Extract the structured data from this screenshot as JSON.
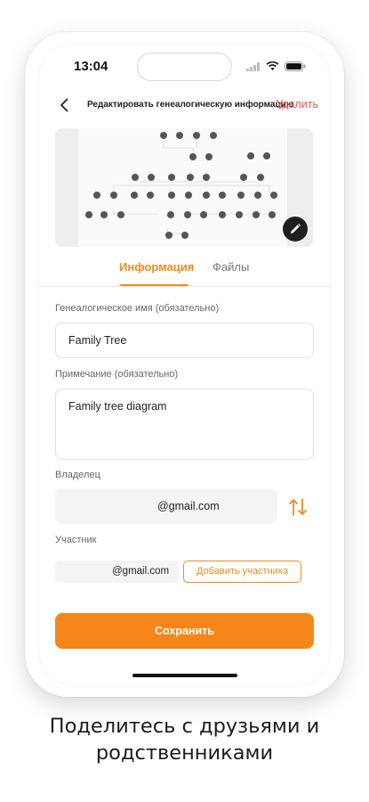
{
  "status_bar": {
    "time": "13:04"
  },
  "header": {
    "title": "Редактировать генеалогическую информацию",
    "delete_label": "Удалить"
  },
  "tabs": [
    {
      "label": "Информация",
      "active": true
    },
    {
      "label": "Файлы",
      "active": false
    }
  ],
  "form": {
    "name_label": "Генеалогическое имя (обязательно)",
    "name_value": "Family Tree",
    "note_label": "Примечание (обязательно)",
    "note_value": "Family tree diagram",
    "owner_label": "Владелец",
    "owner_value": "@gmail.com",
    "member_label": "Участник",
    "member_value": "@gmail.com",
    "add_member_label": "Добавить участника",
    "save_label": "Сохранить"
  },
  "caption": {
    "line1": "Поделитесь с друзьями и",
    "line2": "родственниками"
  },
  "colors": {
    "accent": "#f7861a",
    "delete": "#e2584f",
    "field_bg": "#f4f4f4"
  },
  "icons": [
    "back-chevron-icon",
    "wifi-icon",
    "battery-icon",
    "signal-icon",
    "pencil-icon",
    "swap-arrows-icon"
  ]
}
